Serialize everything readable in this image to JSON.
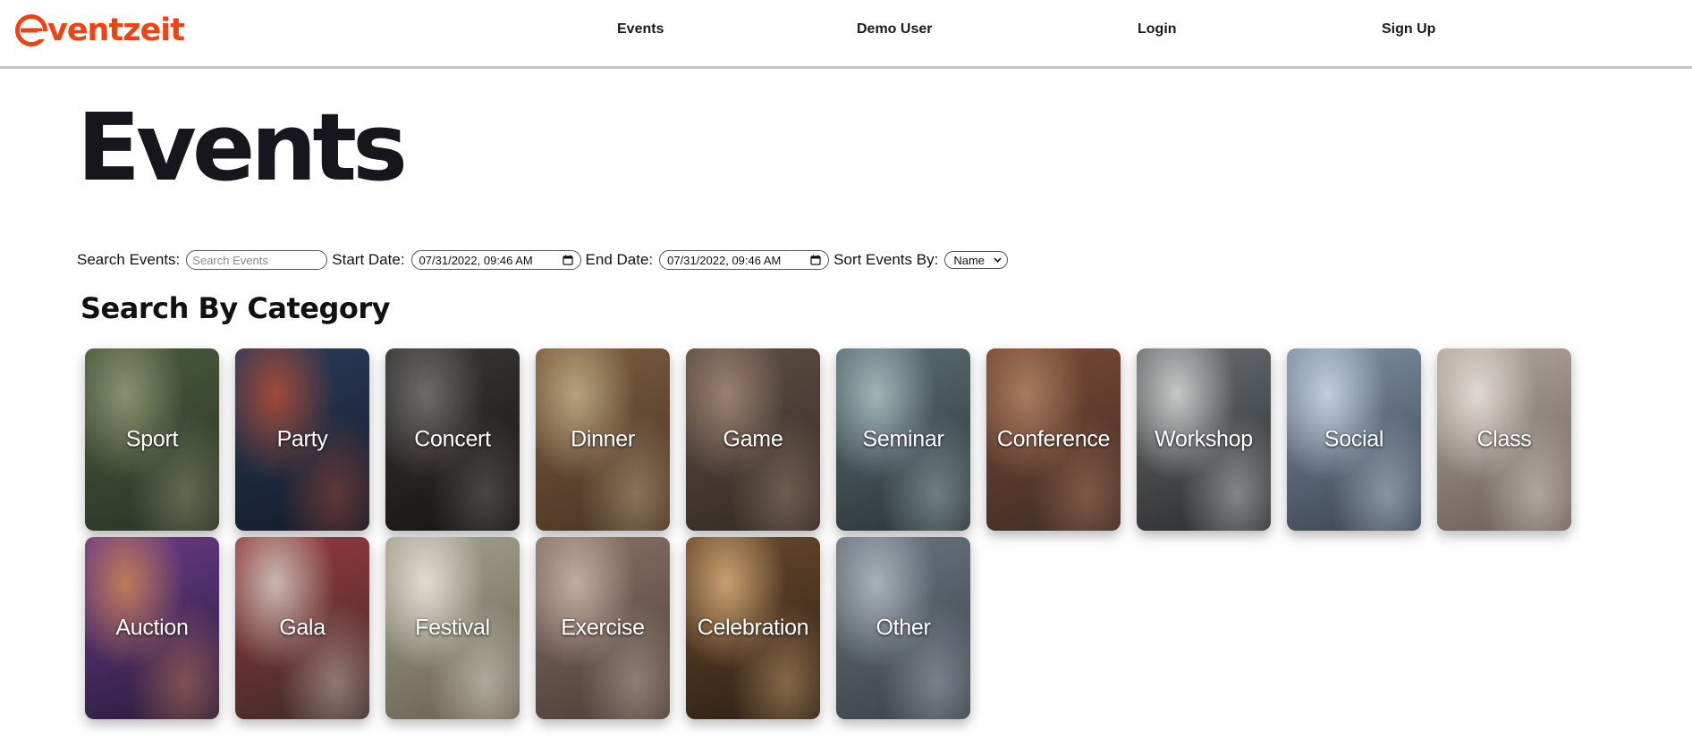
{
  "header": {
    "logo_text": "ventzeit",
    "brand_color": "#ee4414",
    "nav": [
      {
        "label": "Events"
      },
      {
        "label": "Demo User"
      },
      {
        "label": "Login"
      },
      {
        "label": "Sign Up"
      }
    ]
  },
  "page": {
    "title": "Events"
  },
  "filters": {
    "search_label": "Search Events:",
    "search_placeholder": "Search Events",
    "search_value": "",
    "start_label": "Start Date:",
    "start_value": "07/31/2022, 09:46 AM",
    "end_label": "End Date:",
    "end_value": "07/31/2022, 09:46 AM",
    "sort_label": "Sort Events By:",
    "sort_value": "Name",
    "calendar_icon": "calendar-icon",
    "dropdown_icon": "chevron-down-icon"
  },
  "categories": {
    "title": "Search By Category",
    "items": [
      {
        "label": "Sport",
        "colors": [
          "#4a5a3c",
          "#2b3326",
          "#8a9070"
        ]
      },
      {
        "label": "Party",
        "colors": [
          "#2a3c5a",
          "#131a28",
          "#a04a3a"
        ]
      },
      {
        "label": "Concert",
        "colors": [
          "#3a3636",
          "#151313",
          "#6e6a66"
        ]
      },
      {
        "label": "Dinner",
        "colors": [
          "#7a5c40",
          "#4a3424",
          "#b7a27e"
        ]
      },
      {
        "label": "Game",
        "colors": [
          "#5e4e44",
          "#342a24",
          "#9a8070"
        ]
      },
      {
        "label": "Seminar",
        "colors": [
          "#5a6e74",
          "#2c3438",
          "#a0b4b6"
        ]
      },
      {
        "label": "Conference",
        "colors": [
          "#7a4a34",
          "#3e2c24",
          "#a87a60"
        ]
      },
      {
        "label": "Workshop",
        "colors": [
          "#6a6e70",
          "#2a2c2e",
          "#c4c8c6"
        ]
      },
      {
        "label": "Social",
        "colors": [
          "#7e90a4",
          "#3a4250",
          "#c0cede"
        ]
      },
      {
        "label": "Class",
        "colors": [
          "#b0a6a0",
          "#6a5c56",
          "#e0d8d2"
        ]
      },
      {
        "label": "Auction",
        "colors": [
          "#6a3a8a",
          "#2a1c3a",
          "#c07a5a"
        ]
      },
      {
        "label": "Gala",
        "colors": [
          "#9a3a3c",
          "#3a2a28",
          "#c8b8b0"
        ]
      },
      {
        "label": "Festival",
        "colors": [
          "#a4a290",
          "#6a6050",
          "#e0dcd0"
        ]
      },
      {
        "label": "Exercise",
        "colors": [
          "#8a7266",
          "#4a3c36",
          "#c0aca0"
        ]
      },
      {
        "label": "Celebration",
        "colors": [
          "#6a4a2c",
          "#2c1e14",
          "#c8a070"
        ]
      },
      {
        "label": "Other",
        "colors": [
          "#6a7480",
          "#3a4048",
          "#a8b0b8"
        ]
      }
    ]
  }
}
